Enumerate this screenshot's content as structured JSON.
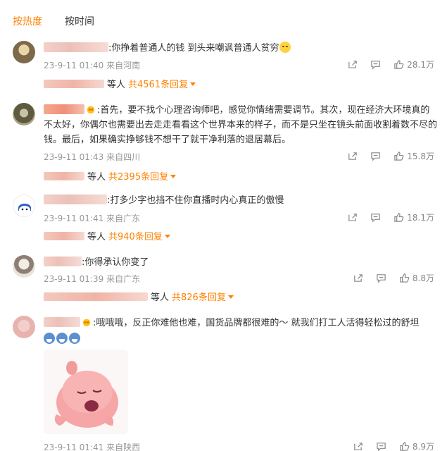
{
  "tabs": [
    {
      "label": "按热度",
      "active": true
    },
    {
      "label": "按时间",
      "active": false
    }
  ],
  "colors": {
    "accent": "#ff8200",
    "meta": "#999999"
  },
  "comments": [
    {
      "text": ":你挣着普通人的钱 到头来嘲讽普通人贫穷",
      "has_emoji": true,
      "date": "23-9-11 01:40",
      "location": "来自河南",
      "likes": "28.1万",
      "reply_suffix": "等人",
      "reply_count": "共4561条回复"
    },
    {
      "text": ":首先，要不找个心理咨询师吧，感觉你情绪需要调节。其次，现在经济大环境真的不太好，你偶尔也需要出去走走看看这个世界本来的样子，而不是只坐在镜头前面收割着数不尽的钱。最后，如果确实挣够钱不想干了就干净利落的退居幕后。",
      "date": "23-9-11 01:43",
      "location": "来自四川",
      "likes": "15.8万",
      "reply_suffix": "等人",
      "reply_count": "共2395条回复"
    },
    {
      "text": ":打多少字也挡不住你直播时内心真正的傲慢",
      "date": "23-9-11 01:41",
      "location": "来自广东",
      "likes": "18.1万",
      "reply_suffix": "等人",
      "reply_count": "共940条回复"
    },
    {
      "text": ":你得承认你变了",
      "date": "23-9-11 01:39",
      "location": "来自广东",
      "likes": "8.8万",
      "reply_suffix": "等人",
      "reply_count": "共826条回复"
    },
    {
      "text": ":哦哦哦，反正你难他也难，国货品牌都很难的～ 就我们打工人活得轻松过的舒坦",
      "date": "23-9-11 01:41",
      "location": "来自陕西",
      "likes": "8.9万"
    }
  ],
  "icons": [
    "share-icon",
    "comment-icon",
    "like-icon",
    "crown-badge-icon"
  ]
}
